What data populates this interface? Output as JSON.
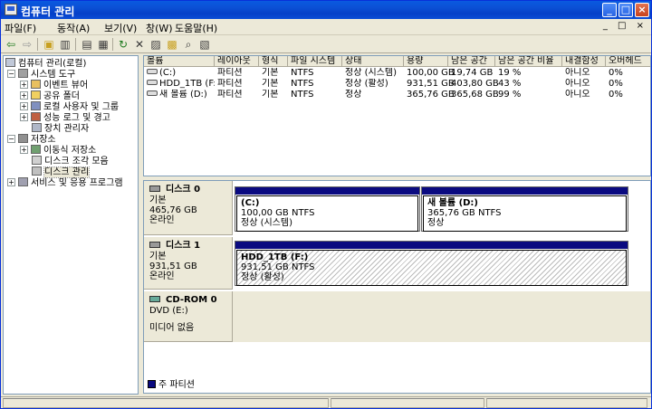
{
  "window": {
    "title": "컴퓨터 관리",
    "controls": [
      "_",
      "□",
      "×"
    ]
  },
  "menu": [
    "파일(F)",
    "동작(A)",
    "보기(V)",
    "창(W)",
    "도움말(H)"
  ],
  "mdi_controls": "_ □ ×",
  "toolbar": {
    "icons": [
      "back-icon",
      "forward-icon",
      "up-folder-icon",
      "show-tree-icon",
      "properties-icon",
      "list-icon",
      "refresh-icon",
      "delete-icon",
      "drive-props-icon",
      "open-icon",
      "search-icon",
      "settings-icon"
    ]
  },
  "tree": {
    "root": "컴퓨터 관리(로컬)",
    "system_tools": "시스템 도구",
    "event_viewer": "이벤트 뷰어",
    "shared_folders": "공유 폴더",
    "local_users": "로컬 사용자 및 그룹",
    "perf_logs": "성능 로그 및 경고",
    "device_manager": "장치 관리자",
    "storage": "저장소",
    "removable": "이동식 저장소",
    "defrag": "디스크 조각 모음",
    "disk_mgmt": "디스크 관리",
    "services": "서비스 및 응용 프로그램"
  },
  "volumes": {
    "headers": [
      "볼륨",
      "레이아웃",
      "형식",
      "파일 시스템",
      "상태",
      "용량",
      "남은 공간",
      "남은 공간 비율",
      "내결함성",
      "오버헤드"
    ],
    "rows": [
      [
        "(C:)",
        "파티션",
        "기본",
        "NTFS",
        "정상 (시스템)",
        "100,00 GB",
        "19,74 GB",
        "19 %",
        "아니오",
        "0%"
      ],
      [
        "HDD_1TB (F:)",
        "파티션",
        "기본",
        "NTFS",
        "정상 (활성)",
        "931,51 GB",
        "403,80 GB",
        "43 %",
        "아니오",
        "0%"
      ],
      [
        "새 볼륨 (D:)",
        "파티션",
        "기본",
        "NTFS",
        "정상",
        "365,76 GB",
        "365,68 GB",
        "99 %",
        "아니오",
        "0%"
      ]
    ]
  },
  "disks": {
    "disk0": {
      "name": "디스크 0",
      "type": "기본",
      "size": "465,76 GB",
      "status": "온라인",
      "p1": {
        "label": "(C:)",
        "size": "100,00 GB NTFS",
        "status": "정상 (시스템)"
      },
      "p2": {
        "label": "새 볼륨  (D:)",
        "size": "365,76 GB NTFS",
        "status": "정상"
      }
    },
    "disk1": {
      "name": "디스크 1",
      "type": "기본",
      "size": "931,51 GB",
      "status": "온라인",
      "p1": {
        "label": "HDD_1TB  (F:)",
        "size": "931,51 GB NTFS",
        "status": "정상 (활성)"
      }
    },
    "cdrom": {
      "name": "CD-ROM 0",
      "type": "DVD (E:)",
      "status": "미디어 없음"
    }
  },
  "legend": "주 파티션",
  "colors": {
    "title_bar": "#0b4fd4",
    "primary_partition": "#0a0a80"
  }
}
